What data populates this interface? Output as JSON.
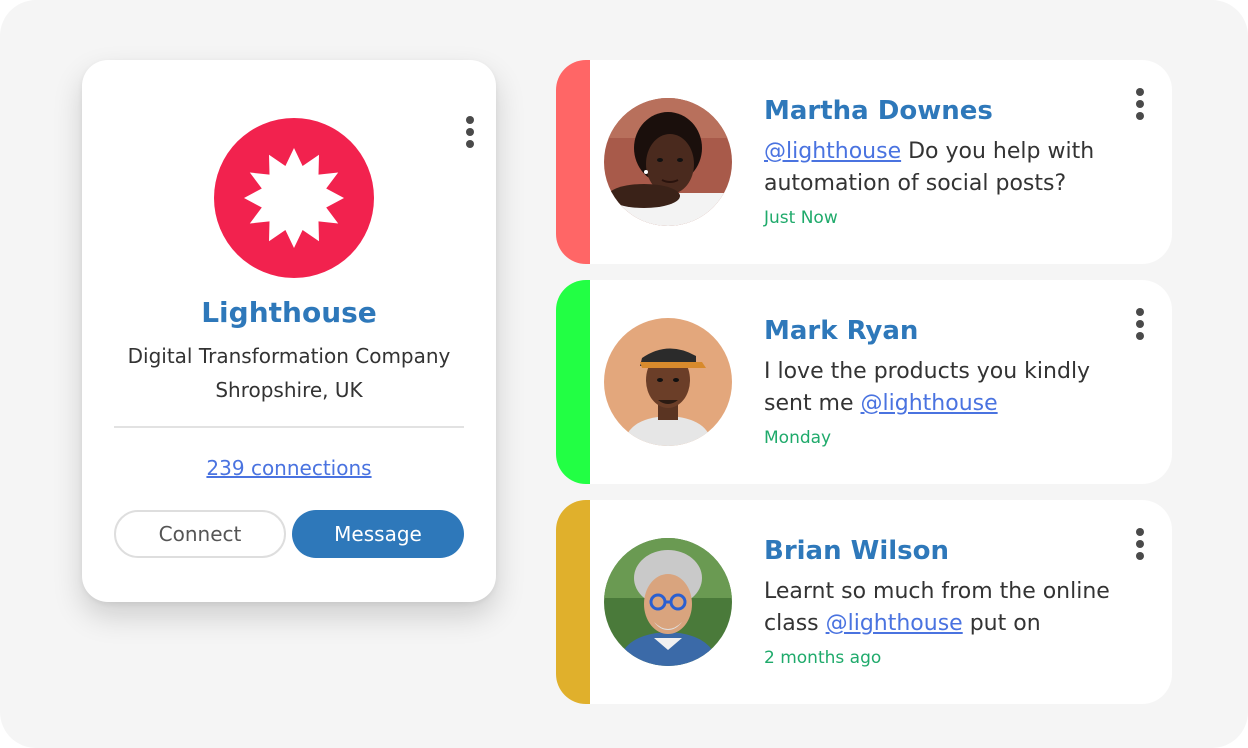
{
  "profile": {
    "name": "Lighthouse",
    "description": "Digital Transformation Company",
    "location": "Shropshire, UK",
    "connections": "239 connections",
    "connect_label": "Connect",
    "message_label": "Message",
    "logo_color": "#f2224e"
  },
  "messages": [
    {
      "name": "Martha Downes",
      "text_before": "",
      "mention": "@lighthouse",
      "text_after": " Do you help with automation of social posts?",
      "time": "Just Now",
      "accent": "#ff6666"
    },
    {
      "name": "Mark Ryan",
      "text_before": "I love the products you kindly sent me ",
      "mention": "@lighthouse",
      "text_after": "",
      "time": "Monday",
      "accent": "#22ff44"
    },
    {
      "name": "Brian Wilson",
      "text_before": "Learnt so much from the online class ",
      "mention": "@lighthouse",
      "text_after": " put on",
      "time": "2 months ago",
      "accent": "#e0b02c"
    }
  ],
  "colors": {
    "brand_blue": "#2e78ba",
    "link_blue": "#4a73e0",
    "time_green": "#1faa6b"
  }
}
